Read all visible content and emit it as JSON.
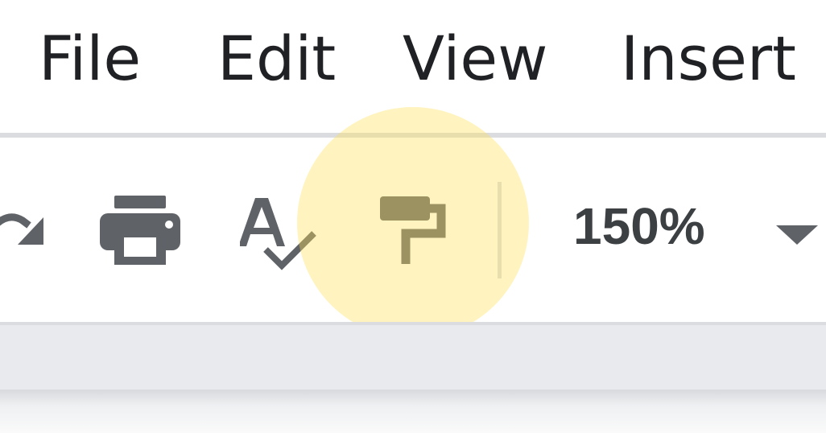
{
  "menubar": {
    "items": [
      {
        "label": "File"
      },
      {
        "label": "Edit"
      },
      {
        "label": "View"
      },
      {
        "label": "Insert"
      }
    ]
  },
  "toolbar": {
    "icons": [
      "redo-icon",
      "print-icon",
      "spellcheck-icon",
      "paint-format-icon",
      "dropdown-arrow-icon"
    ],
    "zoom": {
      "value": "150%"
    }
  },
  "colors": {
    "menu_text": "#202124",
    "icon": "#5f6368",
    "divider": "#dadce0",
    "highlight": "#ffdf56",
    "ruler_background": "#e8eaed"
  }
}
